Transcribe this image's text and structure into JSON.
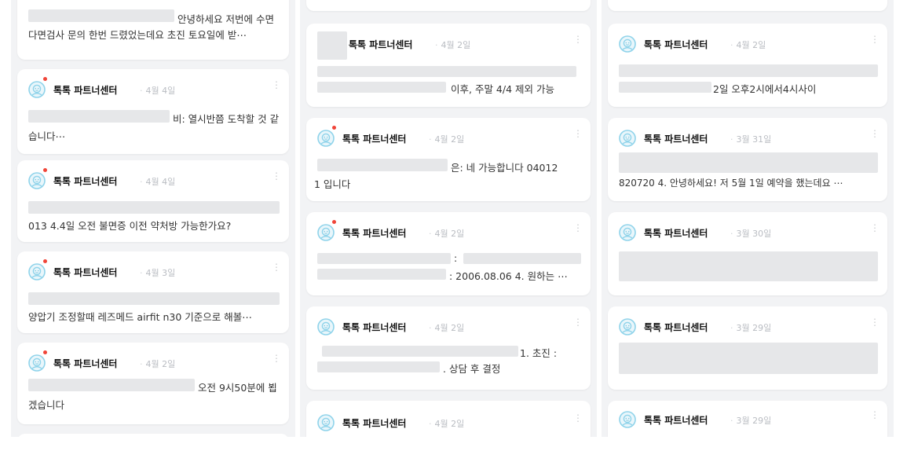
{
  "sender": "톡톡 파트너센터",
  "more_icon": "⋮",
  "accent_dot": "#f04438",
  "col1": {
    "card0": {
      "line1": "안녕하세요 저번에 수면",
      "line2": "다면검사 문의 한번 드렸었는데요 초진 토요일에 받⋯"
    },
    "card1": {
      "date": "4월 4일",
      "line1": "비: 열시반쯤 도착할 것 같",
      "line2": "습니다⋯"
    },
    "card2": {
      "date": "4월 4일",
      "line2": "013 4.4일 오전 불면증 이전 약처방 가능한가요?"
    },
    "card3": {
      "date": "4월 3일",
      "line2": "양압기 조정할때 레즈메드 airfit n30 기준으로 해볼⋯"
    },
    "card4": {
      "date": "4월 2일",
      "line1": "오전 9시50분에 뵙",
      "line2": "겠습니다"
    }
  },
  "col2": {
    "card1": {
      "date": "4월 2일",
      "line2": "이후, 주말 4/4 제외 가능"
    },
    "card2": {
      "date": "4월 2일",
      "line1": "은: 네 가능합니다 04012",
      "line2": "1 입니다"
    },
    "card3": {
      "date": "4월 2일",
      "line1": ":",
      "line2": ": 2006.08.06 4. 원하는 ⋯"
    },
    "card4": {
      "date": "4월 2일",
      "line1": "1. 초진 :",
      "line2": ". 상담 후 결정"
    },
    "card5": {
      "date": "4월 2일"
    }
  },
  "col3": {
    "card1": {
      "date": "4월 2일",
      "line2": "2일 오후2시에서4시사이"
    },
    "card2": {
      "date": "3월 31일",
      "line2": "820720 4. 안녕하세요! 저 5월 1일 예약을 했는데요 ⋯"
    },
    "card3": {
      "date": "3월 30일"
    },
    "card4": {
      "date": "3월 29일"
    },
    "card5": {
      "date": "3월 29일"
    }
  }
}
